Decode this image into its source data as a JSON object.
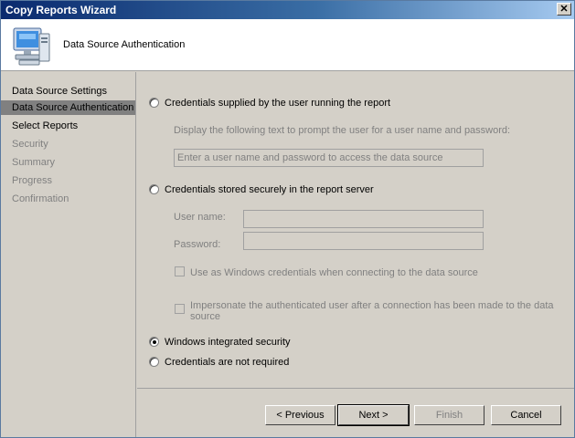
{
  "window": {
    "title": "Copy Reports Wizard",
    "close_glyph": "✕"
  },
  "header": {
    "title": "Data Source Authentication",
    "icon": "computer-wizard-icon"
  },
  "sidebar": {
    "items": [
      {
        "label": "Data Source Settings",
        "state": "done"
      },
      {
        "label": "Data Source Authentication",
        "state": "active"
      },
      {
        "label": "Select Reports",
        "state": "done"
      },
      {
        "label": "Security",
        "state": "pending"
      },
      {
        "label": "Summary",
        "state": "pending"
      },
      {
        "label": "Progress",
        "state": "pending"
      },
      {
        "label": "Confirmation",
        "state": "pending"
      }
    ]
  },
  "options": {
    "user_supplied": {
      "label": "Credentials supplied by the user running the report",
      "prompt_label": "Display the following text to prompt the user for a user name and password:",
      "prompt_placeholder": "Enter a user name and password to access the data source"
    },
    "stored": {
      "label": "Credentials stored securely in the report server",
      "username_label": "User name:",
      "password_label": "Password:",
      "windows_creds_label": "Use as Windows credentials when connecting to the data source",
      "impersonate_label_line1": "Impersonate the authenticated user after a connection has been made to the data",
      "impersonate_label_line2": "source"
    },
    "windows_integrated": {
      "label": "Windows integrated security",
      "selected": true
    },
    "not_required": {
      "label": "Credentials are not required"
    }
  },
  "buttons": {
    "previous": "< Previous",
    "next": "Next >",
    "finish": "Finish",
    "cancel": "Cancel"
  }
}
